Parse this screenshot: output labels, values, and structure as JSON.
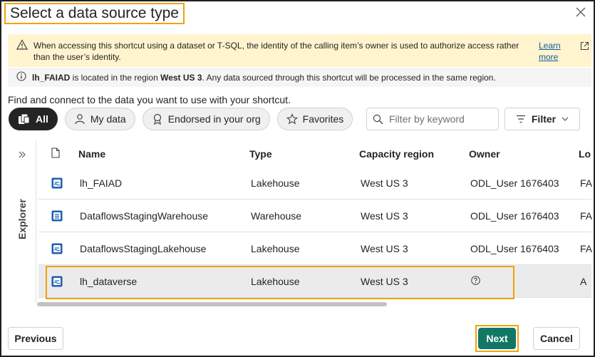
{
  "dialog": {
    "title": "Select a data source type",
    "close_icon": "close-icon"
  },
  "warning": {
    "icon": "warning-icon",
    "text": "When accessing this shortcut using a dataset or T-SQL, the identity of the calling item’s owner is used to authorize access rather than the user’s identity.",
    "link": "Learn more",
    "link_icon": "external-link-icon",
    "bg_color": "#fff4ce"
  },
  "info": {
    "icon": "info-icon",
    "item_name": "lh_FAIAD",
    "text_mid": " is located in the region ",
    "region": "West US 3",
    "text_end": ". Any data sourced through this shortcut will be processed in the same region."
  },
  "intro": "Find and connect to the data you want to use with your shortcut.",
  "pills": [
    {
      "label": "All",
      "icon": "all-items-icon",
      "active": true
    },
    {
      "label": "My data",
      "icon": "person-icon",
      "active": false
    },
    {
      "label": "Endorsed in your org",
      "icon": "badge-icon",
      "active": false
    },
    {
      "label": "Favorites",
      "icon": "star-icon",
      "active": false
    }
  ],
  "search": {
    "placeholder": "Filter by keyword",
    "icon": "search-icon"
  },
  "filter": {
    "label": "Filter",
    "icon": "filter-icon",
    "chevron": "chevron-down-icon"
  },
  "explorer": {
    "label": "Explorer",
    "icon": "expand-double-chevron-icon"
  },
  "table": {
    "file_icon": "file-icon",
    "headers": [
      "Name",
      "Type",
      "Capacity region",
      "Owner",
      "Lo"
    ],
    "rows": [
      {
        "name": "lh_FAIAD",
        "type": "Lakehouse",
        "region": "West US 3",
        "owner": "ODL_User 1676403",
        "loc": "FA",
        "icon": "lakehouse-icon"
      },
      {
        "name": "DataflowsStagingWarehouse",
        "type": "Warehouse",
        "region": "West US 3",
        "owner": "ODL_User 1676403",
        "loc": "FA",
        "icon": "warehouse-icon"
      },
      {
        "name": "DataflowsStagingLakehouse",
        "type": "Lakehouse",
        "region": "West US 3",
        "owner": "ODL_User 1676403",
        "loc": "FA",
        "icon": "lakehouse-icon"
      },
      {
        "name": "lh_dataverse",
        "type": "Lakehouse",
        "region": "West US 3",
        "owner": "",
        "owner_icon": "help-circle-icon",
        "loc": "A",
        "icon": "lakehouse-icon",
        "selected": true
      }
    ]
  },
  "buttons": {
    "previous": "Previous",
    "next": "Next",
    "cancel": "Cancel"
  },
  "colors": {
    "primary": "#117865",
    "highlight": "#f0a30a",
    "link": "#115ea3"
  }
}
